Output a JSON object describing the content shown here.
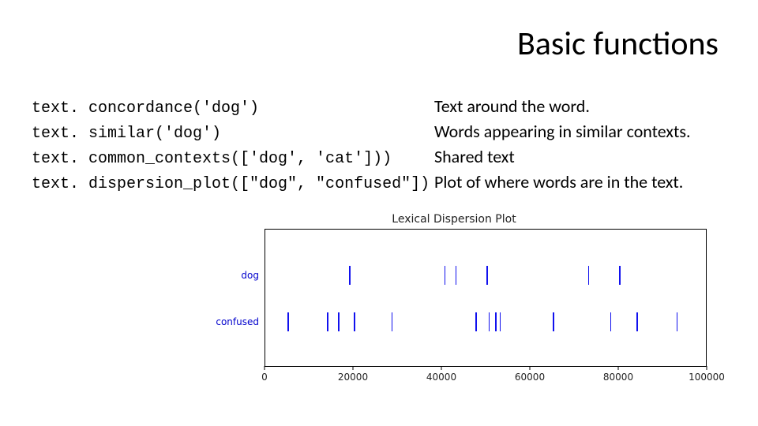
{
  "title": "Basic functions",
  "rows": [
    {
      "code": "text. concordance('dog')",
      "desc": "Text around the word."
    },
    {
      "code": "text. similar('dog')",
      "desc": "Words appearing in similar contexts."
    },
    {
      "code": "text. common_contexts(['dog', 'cat']))",
      "desc": "Shared text"
    },
    {
      "code": "text. dispersion_plot([\"dog\", \"confused\"])",
      "desc": "Plot of where words are in the text."
    }
  ],
  "chart_data": {
    "type": "scatter",
    "title": "Lexical Dispersion Plot",
    "xlabel": "",
    "ylabel": "",
    "xlim": [
      0,
      100000
    ],
    "xticks": [
      0,
      20000,
      40000,
      60000,
      80000,
      100000
    ],
    "categories": [
      "dog",
      "confused"
    ],
    "series": [
      {
        "name": "dog",
        "x": [
          19000,
          40500,
          43000,
          50000,
          73000,
          80000
        ]
      },
      {
        "name": "confused",
        "x": [
          5000,
          14000,
          16500,
          20000,
          28500,
          47500,
          50500,
          52000,
          53000,
          65000,
          78000,
          84000,
          93000
        ]
      }
    ]
  }
}
